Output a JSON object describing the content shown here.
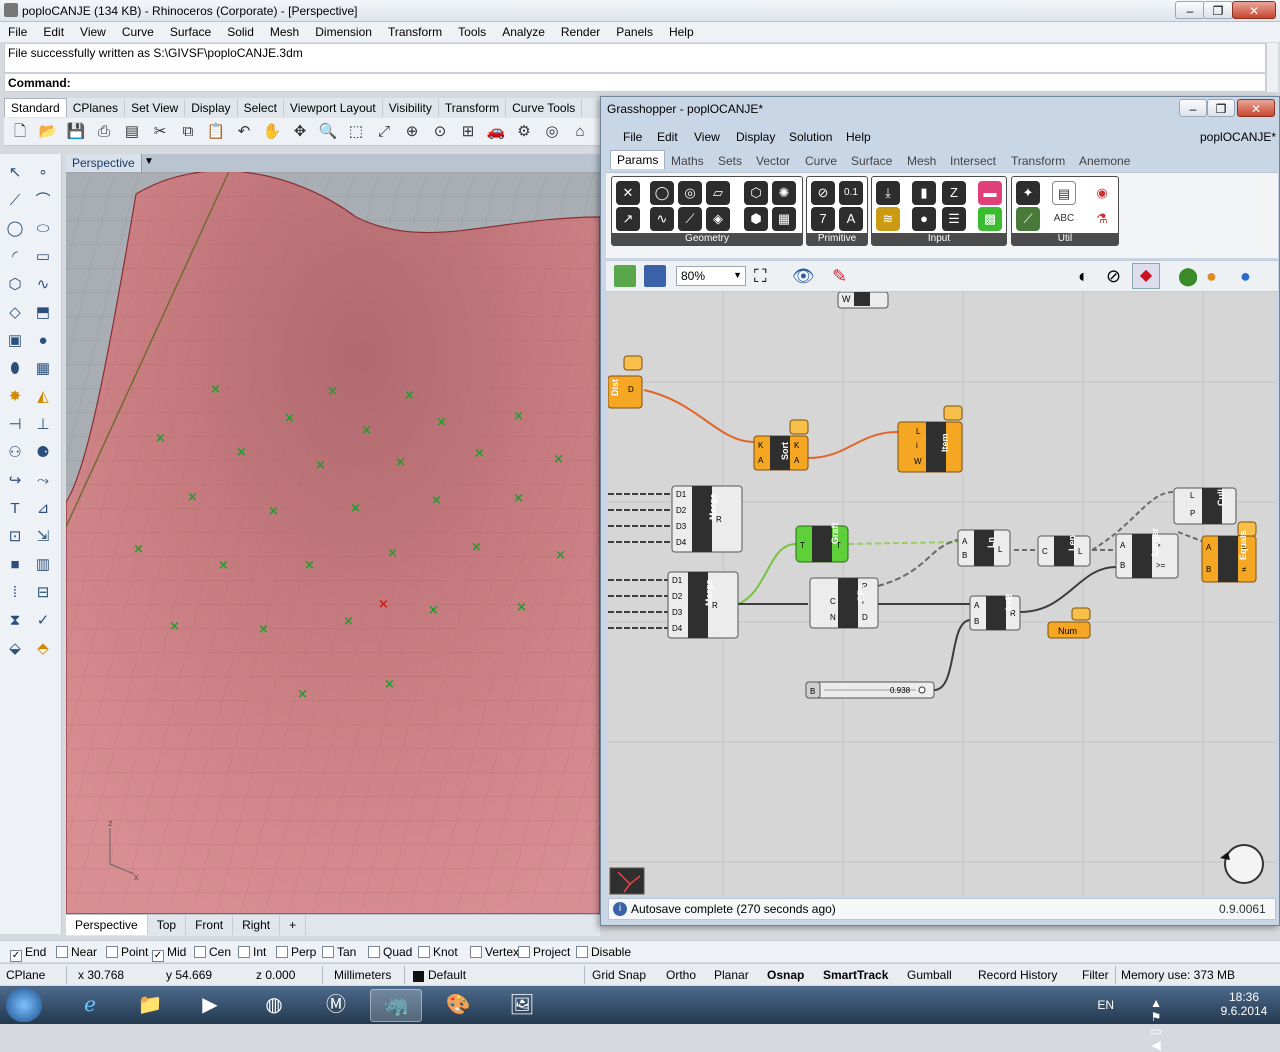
{
  "window": {
    "title": "poploCANJE (134 KB) - Rhinoceros (Corporate) - [Perspective]",
    "controls": [
      "–",
      "❐",
      "✕"
    ]
  },
  "menu": [
    "File",
    "Edit",
    "View",
    "Curve",
    "Surface",
    "Solid",
    "Mesh",
    "Dimension",
    "Transform",
    "Tools",
    "Analyze",
    "Render",
    "Panels",
    "Help"
  ],
  "history_text": "File successfully written as S:\\GIVSF\\poploCANJE.3dm",
  "command_label": "Command:",
  "toolbar_tabs": [
    "Standard",
    "CPlanes",
    "Set View",
    "Display",
    "Select",
    "Viewport Layout",
    "Visibility",
    "Transform",
    "Curve Tools"
  ],
  "viewport": {
    "title": "Perspective",
    "tabs": [
      "Perspective",
      "Top",
      "Front",
      "Right",
      "+"
    ]
  },
  "osnap": [
    {
      "label": "End",
      "checked": true
    },
    {
      "label": "Near",
      "checked": false
    },
    {
      "label": "Point",
      "checked": false
    },
    {
      "label": "Mid",
      "checked": true
    },
    {
      "label": "Cen",
      "checked": false
    },
    {
      "label": "Int",
      "checked": false
    },
    {
      "label": "Perp",
      "checked": false
    },
    {
      "label": "Tan",
      "checked": false
    },
    {
      "label": "Quad",
      "checked": false
    },
    {
      "label": "Knot",
      "checked": false
    },
    {
      "label": "Vertex",
      "checked": false
    },
    {
      "label": "Project",
      "checked": false
    },
    {
      "label": "Disable",
      "checked": false
    }
  ],
  "status": {
    "cplane": "CPlane",
    "x": "x 30.768",
    "y": "y 54.669",
    "z": "z 0.000",
    "units": "Millimeters",
    "layer": "Default",
    "grid_snap": "Grid Snap",
    "ortho": "Ortho",
    "planar": "Planar",
    "osnap": "Osnap",
    "smarttrack": "SmartTrack",
    "gumball": "Gumball",
    "record_history": "Record History",
    "filter": "Filter",
    "memory": "Memory use: 373 MB"
  },
  "taskbar": {
    "lang": "EN",
    "time": "18:36",
    "date": "9.6.2014"
  },
  "grasshopper": {
    "title": "Grasshopper - poplOCANJE*",
    "doc_name": "poplOCANJE*",
    "menu": [
      "File",
      "Edit",
      "View",
      "Display",
      "Solution",
      "Help"
    ],
    "tabs": [
      "Params",
      "Maths",
      "Sets",
      "Vector",
      "Curve",
      "Surface",
      "Mesh",
      "Intersect",
      "Transform",
      "Anemone"
    ],
    "panels": [
      "Geometry",
      "Primitive",
      "Input",
      "Util"
    ],
    "zoom": "80%",
    "status_text": "Autosave complete (270 seconds ago)",
    "version": "0.9.0061",
    "slider": {
      "name": "B",
      "value": "0.938"
    },
    "components": {
      "dist": "Dist",
      "sort": "Sort",
      "item": "Item",
      "merge1": "Merge",
      "merge2": "Merge",
      "graft": "Graft",
      "cps": "CPs",
      "ln": "Ln",
      "len": "Len",
      "larger": "Larger",
      "cull": "Cull",
      "equals": "Equals",
      "add": "A+B",
      "num": "Num"
    }
  },
  "colors": {
    "surface": "#c97a7e",
    "accent_orange": "#f5a623",
    "point_green": "#1e9e2e",
    "point_red": "#d01818"
  }
}
